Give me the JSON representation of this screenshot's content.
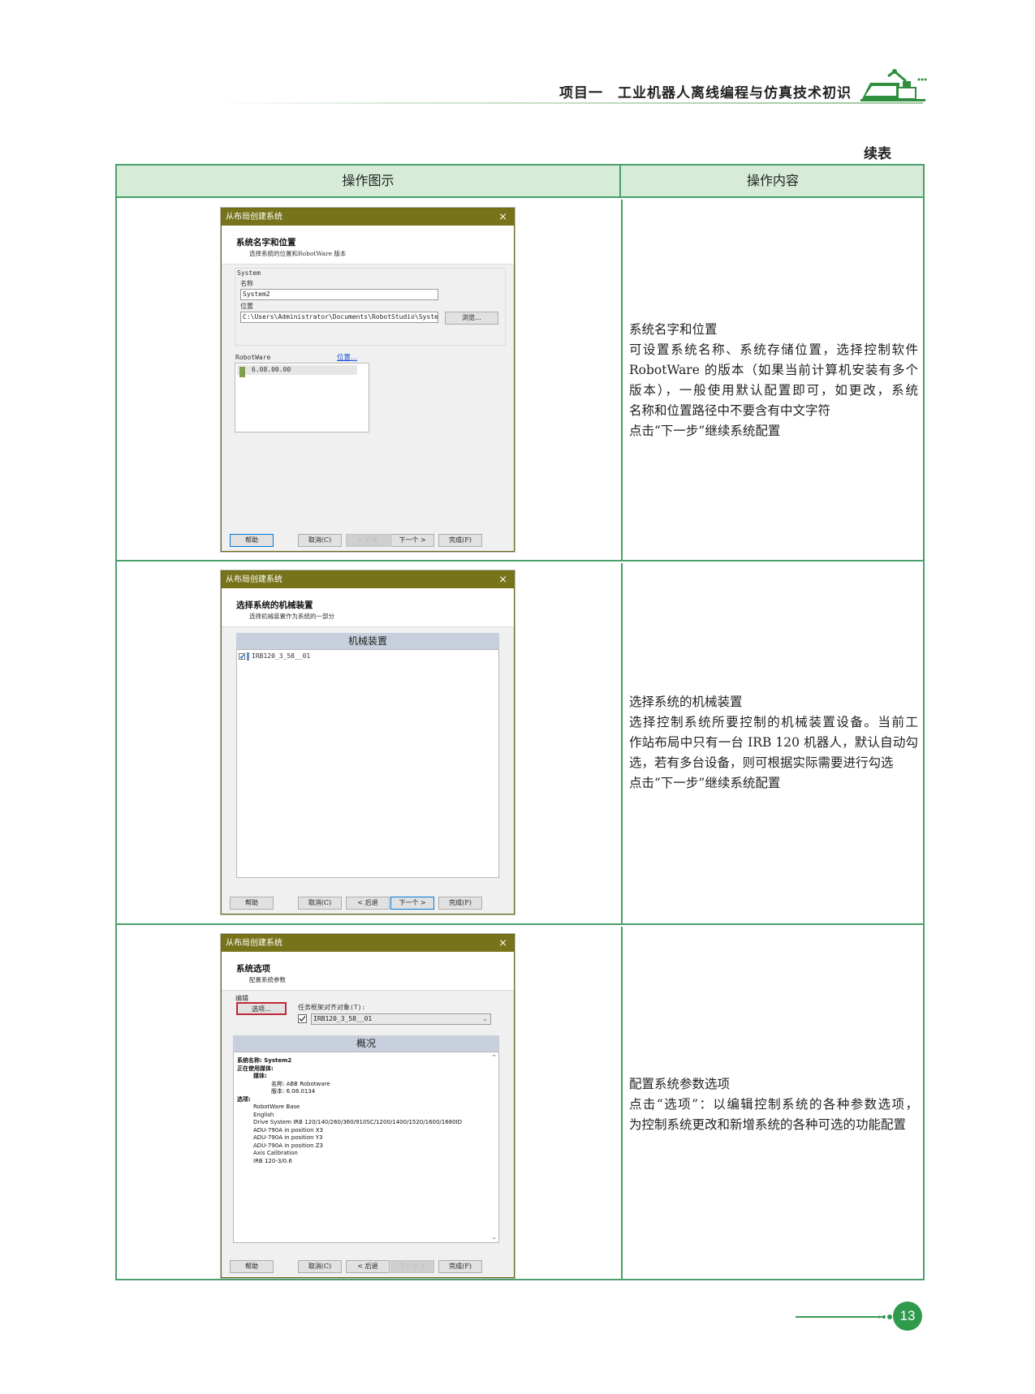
{
  "header": {
    "title": "项目一　工业机器人离线编程与仿真技术初识"
  },
  "continued_label": "续表",
  "table": {
    "col1_header": "操作图示",
    "col2_header": "操作内容"
  },
  "rows": [
    {
      "dialog": {
        "title": "从布局创建系统",
        "close": "×",
        "heading": "系统名字和位置",
        "subheading": "选择系统的位置和RobotWare 版本",
        "group_label": "System",
        "name_label": "名称",
        "name_value": "System2",
        "location_label": "位置",
        "location_value": "C:\\Users\\Administrator\\Documents\\RobotStudio\\Syste",
        "browse_button": "浏览...",
        "robotware_label": "RobotWare",
        "robotware_link": "位置...",
        "robotware_version": "6.08.00.00",
        "buttons": {
          "help": "帮助",
          "cancel": "取消(C)",
          "back": "< 后退",
          "next": "下一个 >",
          "finish": "完成(F)"
        }
      },
      "desc": {
        "title": "系统名字和位置",
        "lines": [
          "可设置系统名称、系统存储位置，选择控制软件",
          "RobotWare 的版本（如果当前计算机安装有多个",
          "版本），一般使用默认配置即可，如更改，系统",
          "名称和位置路径中不要含有中文字符",
          "点击“下一步”继续系统配置"
        ]
      }
    },
    {
      "dialog": {
        "title": "从布局创建系统",
        "close": "×",
        "heading": "选择系统的机械装置",
        "subheading": "选择机械装置作为系统的一部分",
        "band": "机械装置",
        "tree_item": "IRB120_3_58__01",
        "buttons": {
          "help": "帮助",
          "cancel": "取消(C)",
          "back": "< 后退",
          "next": "下一个 >",
          "finish": "完成(F)"
        }
      },
      "desc": {
        "title": "选择系统的机械装置",
        "lines": [
          "选择控制系统所要控制的机械装置设备。当前工",
          "作站布局中只有一台 IRB 120 机器人，默认自动勾",
          "选，若有多台设备，则可根据实际需要进行勾选",
          "点击“下一步”继续系统配置"
        ]
      }
    },
    {
      "dialog": {
        "title": "从布局创建系统",
        "close": "×",
        "heading": "系统选项",
        "subheading": "配置系统参数",
        "edit_label": "编辑",
        "options_button": "选项...",
        "frame_label": "任务框架对齐对象(T):",
        "frame_value": "IRB120_3_58__01",
        "band": "概况",
        "summary": {
          "sysname": "系统名称: System2",
          "media_in_use": "正在使用媒体:",
          "media": "媒体:",
          "media_name": "名称: ABB Robotware",
          "media_version": "版本: 6.08.0134",
          "options_label": "选项:",
          "options": [
            "RobotWare Base",
            "English",
            "Drive System IRB 120/140/260/360/910SC/1200/1400/1520/1600/1660ID",
            "ADU-790A in position X3",
            "ADU-790A in position Y3",
            "ADU-790A in position Z3",
            "Axis Calibration",
            "IRB 120-3/0.6"
          ]
        },
        "buttons": {
          "help": "帮助",
          "cancel": "取消(C)",
          "back": "< 后退",
          "next": "下一个 >",
          "finish": "完成(F)"
        }
      },
      "desc": {
        "title": "配置系统参数选项",
        "lines": [
          "点击“选项”：以编辑控制系统的各种参数选项，",
          "为控制系统更改和新增系统的各种可选的功能配置"
        ]
      }
    }
  ],
  "page_number": "13",
  "colors": {
    "accent": "#49a06a",
    "header_fill": "#d6ecd9",
    "titlebar": "#77731a",
    "page_badge": "#2f9a4c"
  }
}
